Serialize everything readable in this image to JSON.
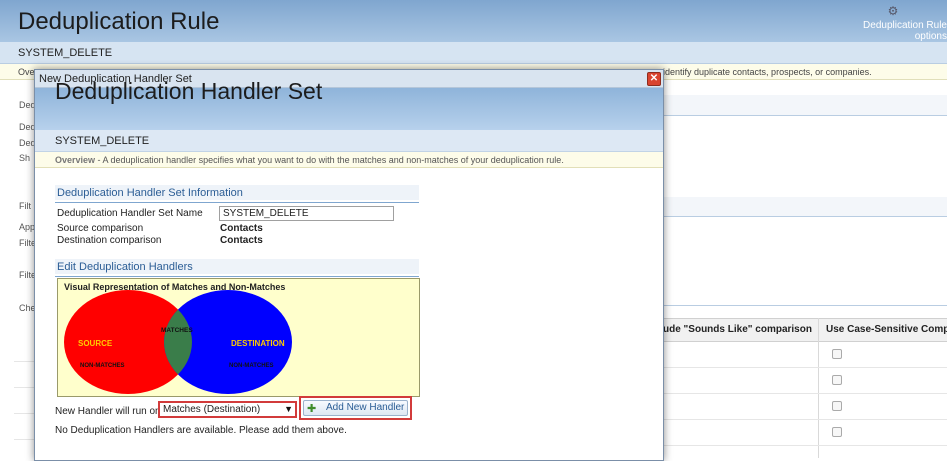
{
  "background": {
    "title": "Deduplication Rule",
    "options_label": "Deduplication Rule options",
    "subtitle": "SYSTEM_DELETE",
    "overview_left": "Ove",
    "overview_right": "identify duplicate contacts, prospects, or companies.",
    "left_labels": [
      "Ded",
      "Ded",
      "Ded",
      "Sh",
      "Filt",
      "App",
      "Filte",
      "Filte",
      "Che"
    ],
    "grid": {
      "col1": "ude \"Sounds Like\" comparison",
      "col2": "Use Case-Sensitive Comparison"
    }
  },
  "dialog": {
    "window_title": "New Deduplication Handler Set",
    "close_glyph": "✕",
    "heading": "Deduplication Handler Set",
    "subtitle": "SYSTEM_DELETE",
    "overview_label": "Overview",
    "overview_text": " - A deduplication handler specifies what you want to do with the matches and non-matches of your deduplication rule.",
    "info_section": {
      "title": "Deduplication Handler Set Information",
      "name_label": "Deduplication Handler Set Name",
      "name_value": "SYSTEM_DELETE",
      "source_label": "Source comparison",
      "source_value": "Contacts",
      "destination_label": "Destination comparison",
      "destination_value": "Contacts"
    },
    "handlers_section": {
      "title": "Edit Deduplication Handlers",
      "venn": {
        "title": "Visual Representation of Matches and Non-Matches",
        "source_label": "SOURCE",
        "destination_label": "DESTINATION",
        "matches_label": "MATCHES",
        "source_nonmatch_label": "NON-MATCHES",
        "dest_nonmatch_label": "NON-MATCHES",
        "colors": {
          "source": "#ff0000",
          "destination": "#0000ff",
          "overlap": "#3a7d4a",
          "source_text": "#ffcc00",
          "dest_text": "#ffcc00"
        }
      },
      "run_on_label": "New Handler will run on",
      "run_on_selected": "Matches (Destination)",
      "add_button": "Add New Handler",
      "empty_message": "No Deduplication Handlers are available. Please add them above."
    }
  },
  "colors": {
    "highlight": "#d23b3b",
    "link": "#2b5d95",
    "header": "#8fb4da"
  }
}
